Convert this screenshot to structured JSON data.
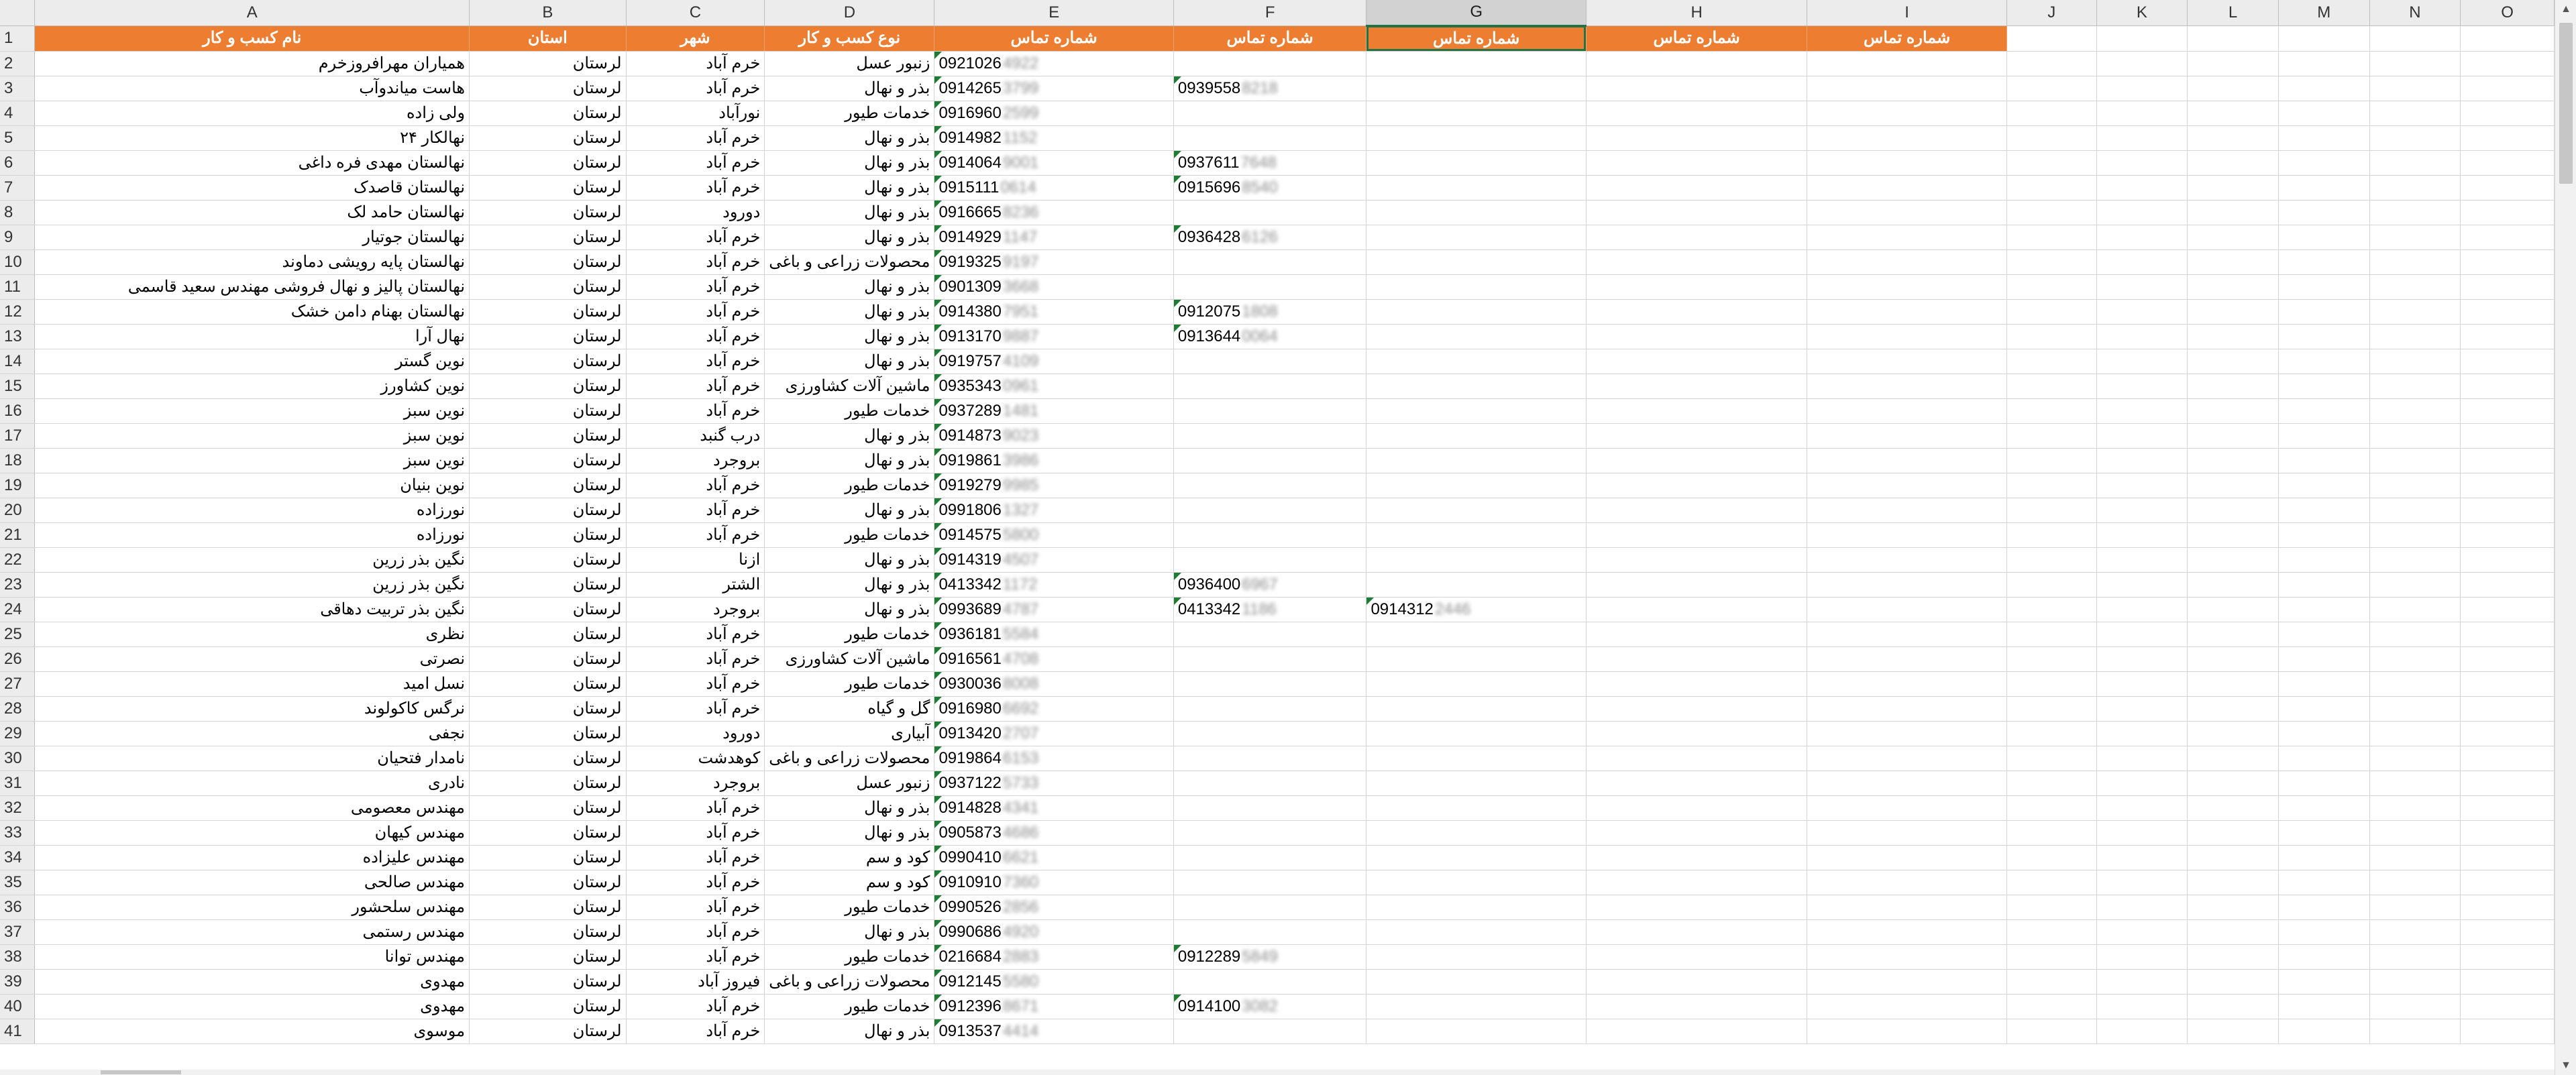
{
  "columns": [
    "A",
    "B",
    "C",
    "D",
    "E",
    "F",
    "G",
    "H",
    "I",
    "J",
    "K",
    "L",
    "M",
    "N",
    "O"
  ],
  "selected_column": "G",
  "header_row": {
    "A": "نام کسب و کار",
    "B": "استان",
    "C": "شهر",
    "D": "نوع کسب و کار",
    "E": "شماره تماس",
    "F": "شماره تماس",
    "G": "شماره تماس",
    "H": "شماره تماس",
    "I": "شماره تماس"
  },
  "header_color": "#ed7d31",
  "rows": [
    {
      "n": "2",
      "name": "همیاران مهرافروزخرم",
      "prov": "لرستان",
      "city": "خرم آباد",
      "type": "زنبور عسل",
      "e": "0921026",
      "eb": "4922"
    },
    {
      "n": "3",
      "name": "هاست میاندوآب",
      "prov": "لرستان",
      "city": "خرم آباد",
      "type": "بذر و نهال",
      "e": "0914265",
      "eb": "3799",
      "f": "0939558",
      "fb": "8218"
    },
    {
      "n": "4",
      "name": "ولی زاده",
      "prov": "لرستان",
      "city": "نورآباد",
      "type": "خدمات طیور",
      "e": "0916960",
      "eb": "2599"
    },
    {
      "n": "5",
      "name": "نهالکار ۲۴",
      "prov": "لرستان",
      "city": "خرم آباد",
      "type": "بذر و نهال",
      "e": "0914982",
      "eb": "1152"
    },
    {
      "n": "6",
      "name": "نهالستان مهدی فره داغی",
      "prov": "لرستان",
      "city": "خرم آباد",
      "type": "بذر و نهال",
      "e": "0914064",
      "eb": "9001",
      "f": "0937611",
      "fb": "7648"
    },
    {
      "n": "7",
      "name": "نهالستان قاصدک",
      "prov": "لرستان",
      "city": "خرم آباد",
      "type": "بذر و نهال",
      "e": "0915111",
      "eb": "0614",
      "f": "0915696",
      "fb": "8540"
    },
    {
      "n": "8",
      "name": "نهالستان حامد لک",
      "prov": "لرستان",
      "city": "دورود",
      "type": "بذر و نهال",
      "e": "0916665",
      "eb": "8236"
    },
    {
      "n": "9",
      "name": "نهالستان جوتیار",
      "prov": "لرستان",
      "city": "خرم آباد",
      "type": "بذر و نهال",
      "e": "0914929",
      "eb": "1147",
      "f": "0936428",
      "fb": "6126"
    },
    {
      "n": "10",
      "name": "نهالستان پایه رویشی دماوند",
      "prov": "لرستان",
      "city": "خرم آباد",
      "type": "محصولات زراعی و باغی",
      "e": "0919325",
      "eb": "9197"
    },
    {
      "n": "11",
      "name": "نهالستان پالیز و نهال فروشی مهندس سعید قاسمی",
      "prov": "لرستان",
      "city": "خرم آباد",
      "type": "بذر و نهال",
      "e": "0901309",
      "eb": "3668"
    },
    {
      "n": "12",
      "name": "نهالستان بهنام دامن خشک",
      "prov": "لرستان",
      "city": "خرم آباد",
      "type": "بذر و نهال",
      "e": "0914380",
      "eb": "7951",
      "f": "0912075",
      "fb": "1808"
    },
    {
      "n": "13",
      "name": "نهال آرا",
      "prov": "لرستان",
      "city": "خرم آباد",
      "type": "بذر و نهال",
      "e": "0913170",
      "eb": "9887",
      "f": "0913644",
      "fb": "0064"
    },
    {
      "n": "14",
      "name": "نوین گستر",
      "prov": "لرستان",
      "city": "خرم آباد",
      "type": "بذر و نهال",
      "e": "0919757",
      "eb": "4109"
    },
    {
      "n": "15",
      "name": "نوین کشاورز",
      "prov": "لرستان",
      "city": "خرم آباد",
      "type": "ماشین آلات کشاورزی",
      "e": "0935343",
      "eb": "0961"
    },
    {
      "n": "16",
      "name": "نوین سبز",
      "prov": "لرستان",
      "city": "خرم آباد",
      "type": "خدمات طیور",
      "e": "0937289",
      "eb": "1481"
    },
    {
      "n": "17",
      "name": "نوین سبز",
      "prov": "لرستان",
      "city": "درب گنبد",
      "type": "بذر و نهال",
      "e": "0914873",
      "eb": "9023"
    },
    {
      "n": "18",
      "name": "نوین سبز",
      "prov": "لرستان",
      "city": "بروجرد",
      "type": "بذر و نهال",
      "e": "0919861",
      "eb": "3986"
    },
    {
      "n": "19",
      "name": "نوین بنیان",
      "prov": "لرستان",
      "city": "خرم آباد",
      "type": "خدمات طیور",
      "e": "0919279",
      "eb": "9985"
    },
    {
      "n": "20",
      "name": "نورزاده",
      "prov": "لرستان",
      "city": "خرم آباد",
      "type": "بذر و نهال",
      "e": "0991806",
      "eb": "1327"
    },
    {
      "n": "21",
      "name": "نورزاده",
      "prov": "لرستان",
      "city": "خرم آباد",
      "type": "خدمات طیور",
      "e": "0914575",
      "eb": "5800"
    },
    {
      "n": "22",
      "name": "نگین بذر زرین",
      "prov": "لرستان",
      "city": "ازنا",
      "type": "بذر و نهال",
      "e": "0914319",
      "eb": "4507"
    },
    {
      "n": "23",
      "name": "نگین بذر زرین",
      "prov": "لرستان",
      "city": "الشتر",
      "type": "بذر و نهال",
      "e": "0413342",
      "eb": "1172",
      "f": "0936400",
      "fb": "6967"
    },
    {
      "n": "24",
      "name": "نگین بذر تربیت دهاقی",
      "prov": "لرستان",
      "city": "بروجرد",
      "type": "بذر و نهال",
      "e": "0993689",
      "eb": "4787",
      "f": "0413342",
      "fb": "1186",
      "g": "0914312",
      "gb": "2446"
    },
    {
      "n": "25",
      "name": "نظری",
      "prov": "لرستان",
      "city": "خرم آباد",
      "type": "خدمات طیور",
      "e": "0936181",
      "eb": "5584"
    },
    {
      "n": "26",
      "name": "نصرتی",
      "prov": "لرستان",
      "city": "خرم آباد",
      "type": "ماشین آلات کشاورزی",
      "e": "0916561",
      "eb": "4708"
    },
    {
      "n": "27",
      "name": "نسل امید",
      "prov": "لرستان",
      "city": "خرم آباد",
      "type": "خدمات طیور",
      "e": "0930036",
      "eb": "8008"
    },
    {
      "n": "28",
      "name": "نرگس کاکولوند",
      "prov": "لرستان",
      "city": "خرم آباد",
      "type": "گل و گیاه",
      "e": "0916980",
      "eb": "6692"
    },
    {
      "n": "29",
      "name": "نجفی",
      "prov": "لرستان",
      "city": "دورود",
      "type": "آبیاری",
      "e": "0913420",
      "eb": "2707"
    },
    {
      "n": "30",
      "name": "نامدار فتحیان",
      "prov": "لرستان",
      "city": "کوهدشت",
      "type": "محصولات زراعی و باغی",
      "e": "0919864",
      "eb": "6153"
    },
    {
      "n": "31",
      "name": "نادری",
      "prov": "لرستان",
      "city": "بروجرد",
      "type": "زنبور عسل",
      "e": "0937122",
      "eb": "5733"
    },
    {
      "n": "32",
      "name": "مهندس معصومی",
      "prov": "لرستان",
      "city": "خرم آباد",
      "type": "بذر و نهال",
      "e": "0914828",
      "eb": "4341"
    },
    {
      "n": "33",
      "name": "مهندس کیهان",
      "prov": "لرستان",
      "city": "خرم آباد",
      "type": "بذر و نهال",
      "e": "0905873",
      "eb": "4686"
    },
    {
      "n": "34",
      "name": "مهندس علیزاده",
      "prov": "لرستان",
      "city": "خرم آباد",
      "type": "کود و سم",
      "e": "0990410",
      "eb": "6621"
    },
    {
      "n": "35",
      "name": "مهندس صالحی",
      "prov": "لرستان",
      "city": "خرم آباد",
      "type": "کود و سم",
      "e": "0910910",
      "eb": "7360"
    },
    {
      "n": "36",
      "name": "مهندس سلحشور",
      "prov": "لرستان",
      "city": "خرم آباد",
      "type": "خدمات طیور",
      "e": "0990526",
      "eb": "2856"
    },
    {
      "n": "37",
      "name": "مهندس رستمی",
      "prov": "لرستان",
      "city": "خرم آباد",
      "type": "بذر و نهال",
      "e": "0990686",
      "eb": "4920"
    },
    {
      "n": "38",
      "name": "مهندس توانا",
      "prov": "لرستان",
      "city": "خرم آباد",
      "type": "خدمات طیور",
      "e": "0216684",
      "eb": "2883",
      "f": "0912289",
      "fb": "5849"
    },
    {
      "n": "39",
      "name": "مهدوی",
      "prov": "لرستان",
      "city": "فیروز آباد",
      "type": "محصولات زراعی و باغی",
      "e": "0912145",
      "eb": "5580"
    },
    {
      "n": "40",
      "name": "مهدوی",
      "prov": "لرستان",
      "city": "خرم آباد",
      "type": "خدمات طیور",
      "e": "0912396",
      "eb": "8671",
      "f": "0914100",
      "fb": "3082"
    },
    {
      "n": "41",
      "name": "موسوی",
      "prov": "لرستان",
      "city": "خرم آباد",
      "type": "بذر و نهال",
      "e": "0913537",
      "eb": "4414"
    }
  ]
}
